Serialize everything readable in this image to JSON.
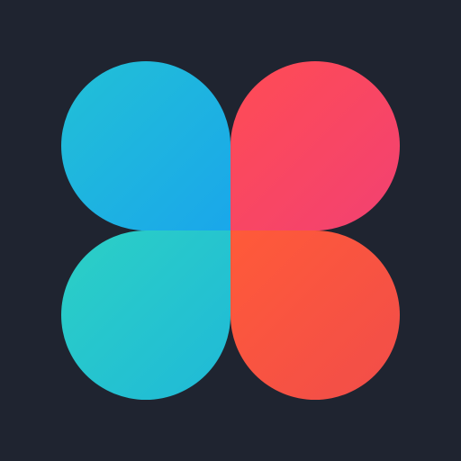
{
  "logo": {
    "name": "four-petal-logo",
    "colors": {
      "background": "#1f2430",
      "top_left_start": "#22c0d6",
      "top_left_end": "#1aa7ea",
      "top_right_start": "#ff4c54",
      "top_right_end": "#f24172",
      "bottom_left_start": "#2cd0c5",
      "bottom_left_end": "#1fb9d8",
      "bottom_right_start": "#ff5a39",
      "bottom_right_end": "#f14d4a"
    }
  }
}
